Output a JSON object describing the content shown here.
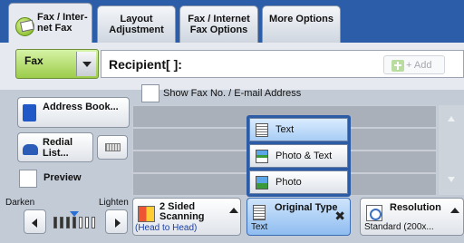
{
  "tabs": [
    {
      "label": "Fax / Inter- net Fax",
      "icon": "fax-service-icon",
      "active": true
    },
    {
      "label": "Layout Adjustment"
    },
    {
      "label": "Fax / Internet Fax Options"
    },
    {
      "label": "More Options"
    }
  ],
  "recipient": {
    "mode": "Fax",
    "label": "Recipient[ ]:",
    "add_label": "+ Add"
  },
  "left_buttons": {
    "address_book": "Address Book...",
    "redial_list": "Redial List...",
    "preview": "Preview"
  },
  "show_fax": "Show Fax No. / E-mail Address",
  "original_type_menu": [
    {
      "label": "Text",
      "icon": "text-document-icon",
      "selected": true
    },
    {
      "label": "Photo & Text",
      "icon": "photo-text-icon",
      "selected": false
    },
    {
      "label": "Photo",
      "icon": "photo-icon",
      "selected": false
    }
  ],
  "density": {
    "darken": "Darken",
    "lighten": "Lighten",
    "level_index": 3,
    "steps": 7
  },
  "features": {
    "two_sided": {
      "title": "2 Sided Scanning",
      "value": "(Head to Head)"
    },
    "original_type": {
      "title": "Original Type",
      "value": "Text"
    },
    "resolution": {
      "title": "Resolution",
      "value": "Standard (200x..."
    }
  },
  "colors": {
    "tabbar": "#2c5da8",
    "fax_mode": "#9ccc4a",
    "selected": "#8fbdf0"
  }
}
